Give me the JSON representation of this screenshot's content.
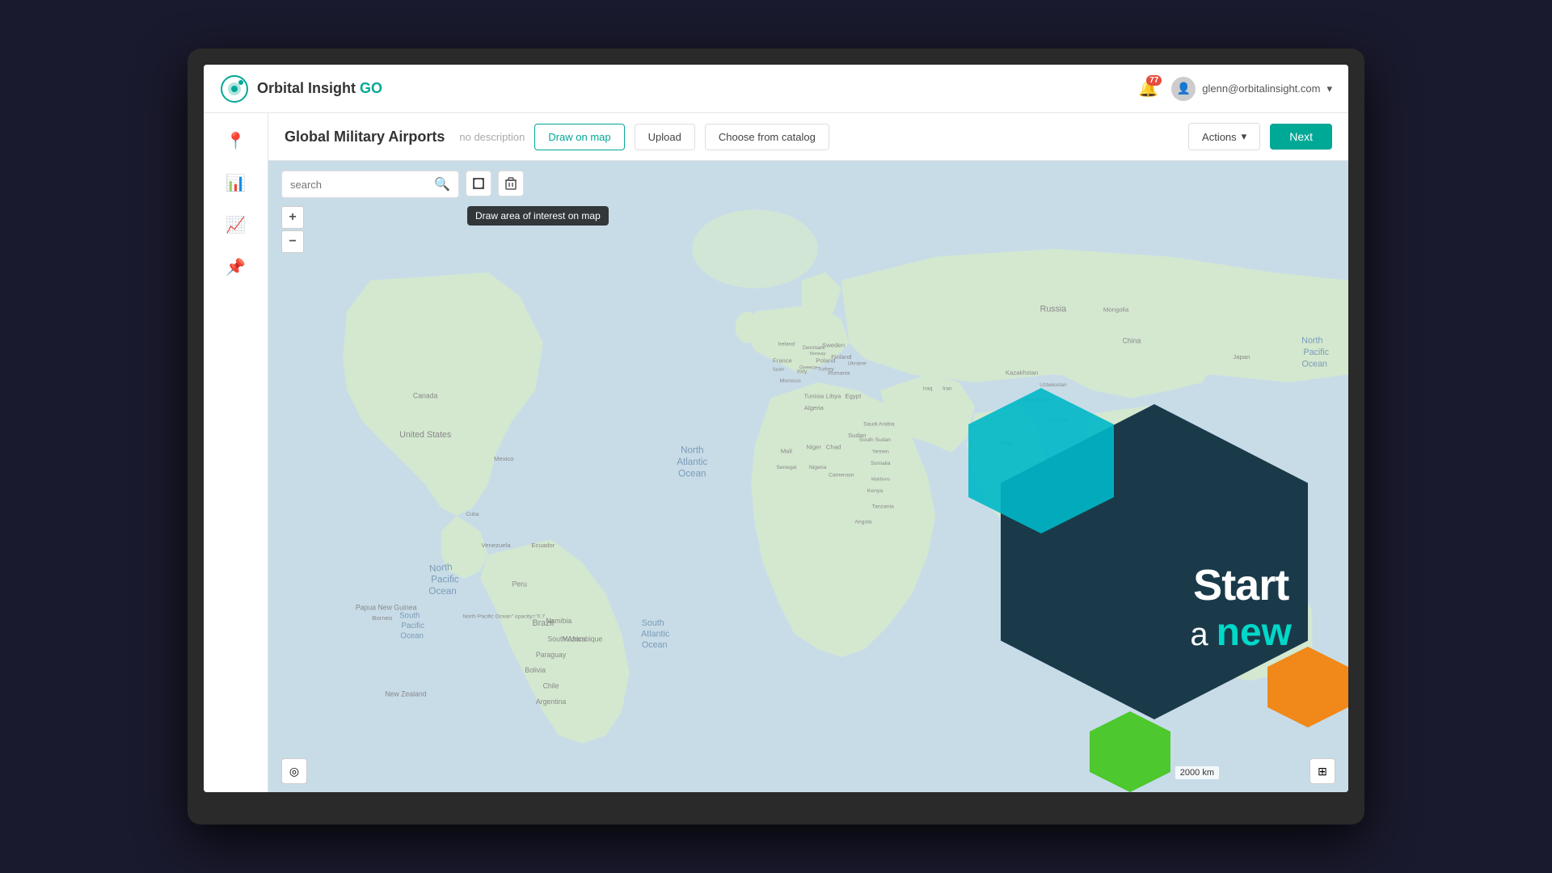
{
  "app": {
    "name": "Orbital Insight",
    "nameHighlight": " GO",
    "logoColor": "#00a896"
  },
  "topbar": {
    "notificationCount": "77",
    "userEmail": "glenn@orbitalinsight.com"
  },
  "sidebar": {
    "items": [
      {
        "id": "location",
        "icon": "📍",
        "label": "Location"
      },
      {
        "id": "chart",
        "icon": "📊",
        "label": "Analytics"
      },
      {
        "id": "bar-chart",
        "icon": "📈",
        "label": "Bar Chart"
      },
      {
        "id": "pin",
        "icon": "📌",
        "label": "Pin"
      }
    ]
  },
  "toolbar": {
    "pageTitle": "Global Military Airports",
    "pageDescription": "no description",
    "buttons": [
      {
        "id": "draw",
        "label": "Draw on map"
      },
      {
        "id": "upload",
        "label": "Upload"
      },
      {
        "id": "catalog",
        "label": "Choose from catalog"
      }
    ],
    "actionsLabel": "Actions",
    "actionsIcon": "▾",
    "nextLabel": "Next"
  },
  "mapControls": {
    "searchPlaceholder": "search",
    "tooltip": "Draw area of interest on map",
    "zoomIn": "+",
    "zoomOut": "−",
    "scaleLabel": "2000 km"
  },
  "hexOverlay": {
    "line1": "Start",
    "line2a": "a",
    "line2b": "new"
  }
}
